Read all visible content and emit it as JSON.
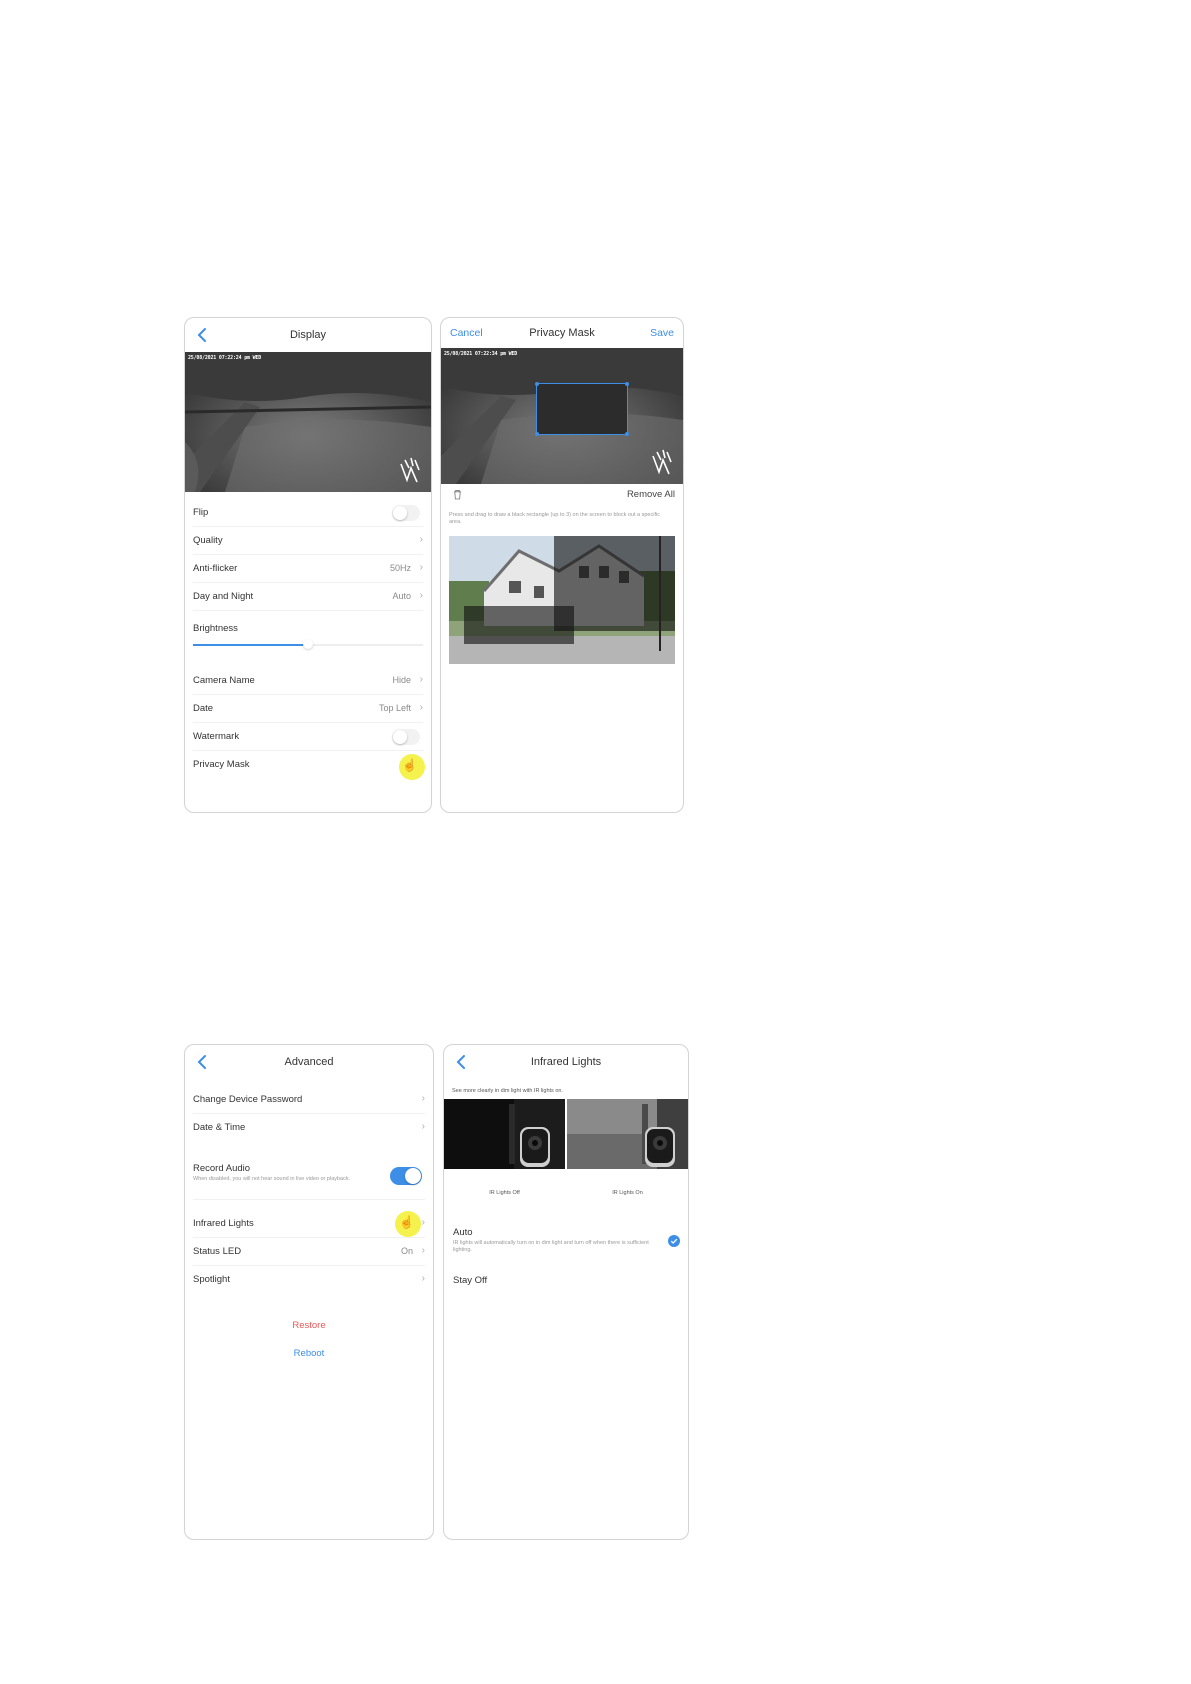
{
  "display": {
    "title": "Display",
    "timestamp": "25/08/2021 07:22:24 pm WED",
    "rows": {
      "flip": "Flip",
      "quality": "Quality",
      "anti_flicker": "Anti-flicker",
      "anti_flicker_value": "50Hz",
      "day_night": "Day and Night",
      "day_night_value": "Auto",
      "brightness": "Brightness",
      "camera_name": "Camera Name",
      "camera_name_value": "Hide",
      "date": "Date",
      "date_value": "Top Left",
      "watermark": "Watermark",
      "privacy_mask": "Privacy Mask"
    },
    "brightness_level": 0.5,
    "flip_on": false,
    "watermark_on": false
  },
  "privacy_mask": {
    "title": "Privacy Mask",
    "cancel": "Cancel",
    "save": "Save",
    "timestamp": "25/08/2021 07:22:34 pm WED",
    "remove_all": "Remove All",
    "hint": "Press and drag to draw a black rectangle (up to 3) on the screen to block out a specific area."
  },
  "advanced": {
    "title": "Advanced",
    "change_password": "Change Device Password",
    "date_time": "Date & Time",
    "record_audio": "Record Audio",
    "record_audio_desc": "When disabled, you will not hear sound in live video or playback.",
    "record_audio_on": true,
    "infrared_lights": "Infrared Lights",
    "status_led": "Status LED",
    "status_led_value": "On",
    "spotlight": "Spotlight",
    "restore": "Restore",
    "reboot": "Reboot"
  },
  "infrared": {
    "title": "Infrared Lights",
    "intro": "See more clearly in dim light with IR lights on.",
    "ir_off_caption": "IR Lights Off",
    "ir_on_caption": "IR Lights On",
    "auto_label": "Auto",
    "auto_desc": "IR lights will automatically turn on in dim light and turn off when there is sufficient lighting.",
    "stay_off_label": "Stay Off",
    "selected": "Auto"
  },
  "colors": {
    "accent": "#3d8ee6",
    "restore": "#e8585a",
    "highlight": "#f5f14d"
  }
}
